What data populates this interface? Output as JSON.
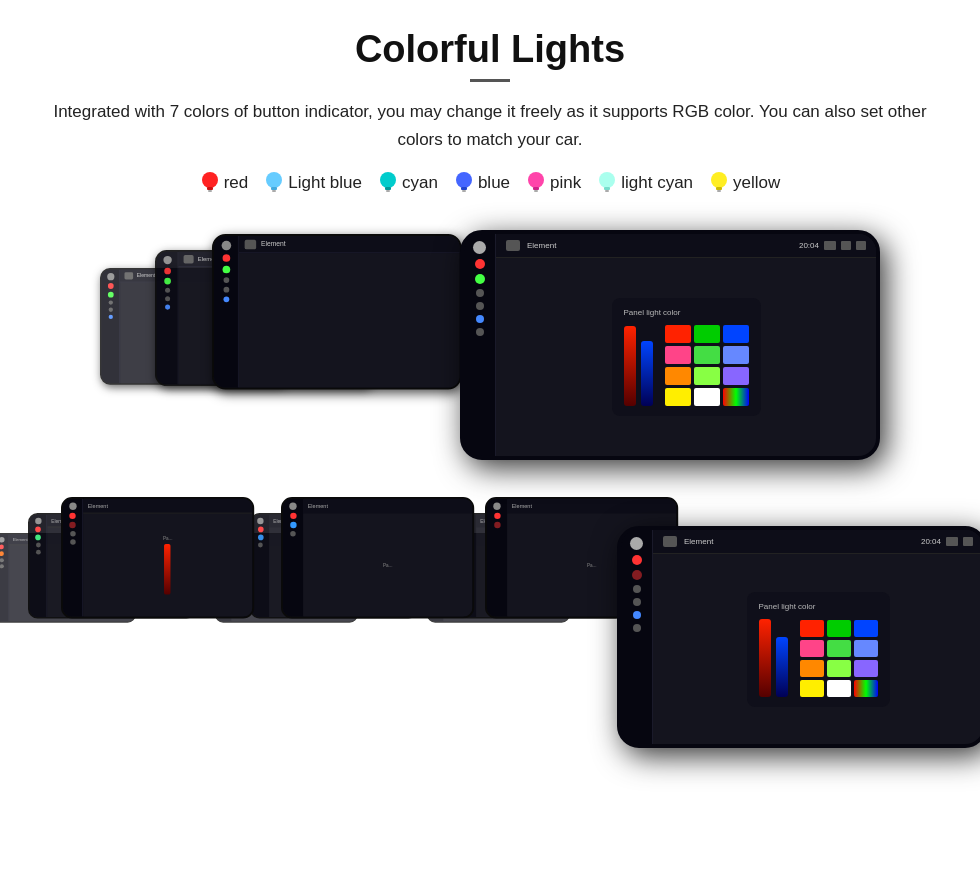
{
  "page": {
    "title": "Colorful Lights",
    "description": "Integrated with 7 colors of button indicator, you may change it freely as it supports RGB color. You can also set other colors to match your car.",
    "colors": [
      {
        "name": "red",
        "color": "#ff2222",
        "bulb_type": "red"
      },
      {
        "name": "Light blue",
        "color": "#66ccff",
        "bulb_type": "lightblue"
      },
      {
        "name": "cyan",
        "color": "#00dddd",
        "bulb_type": "cyan"
      },
      {
        "name": "blue",
        "color": "#4466ff",
        "bulb_type": "blue"
      },
      {
        "name": "pink",
        "color": "#ff44aa",
        "bulb_type": "pink"
      },
      {
        "name": "light cyan",
        "color": "#aaffee",
        "bulb_type": "lightcyan"
      },
      {
        "name": "yellow",
        "color": "#ffee22",
        "bulb_type": "yellow"
      }
    ],
    "panel_label": "Panel light color",
    "topbar_label": "Element"
  },
  "colors": {
    "red": "#ff2222",
    "lightblue": "#66ccff",
    "cyan": "#00dddd",
    "blue": "#4466ff",
    "pink": "#ff44aa",
    "lightcyan": "#aaffee",
    "yellow": "#ffee22",
    "darkbg": "#14141e",
    "sidebarbg": "#080810",
    "topbarbg": "#0d0d18"
  }
}
